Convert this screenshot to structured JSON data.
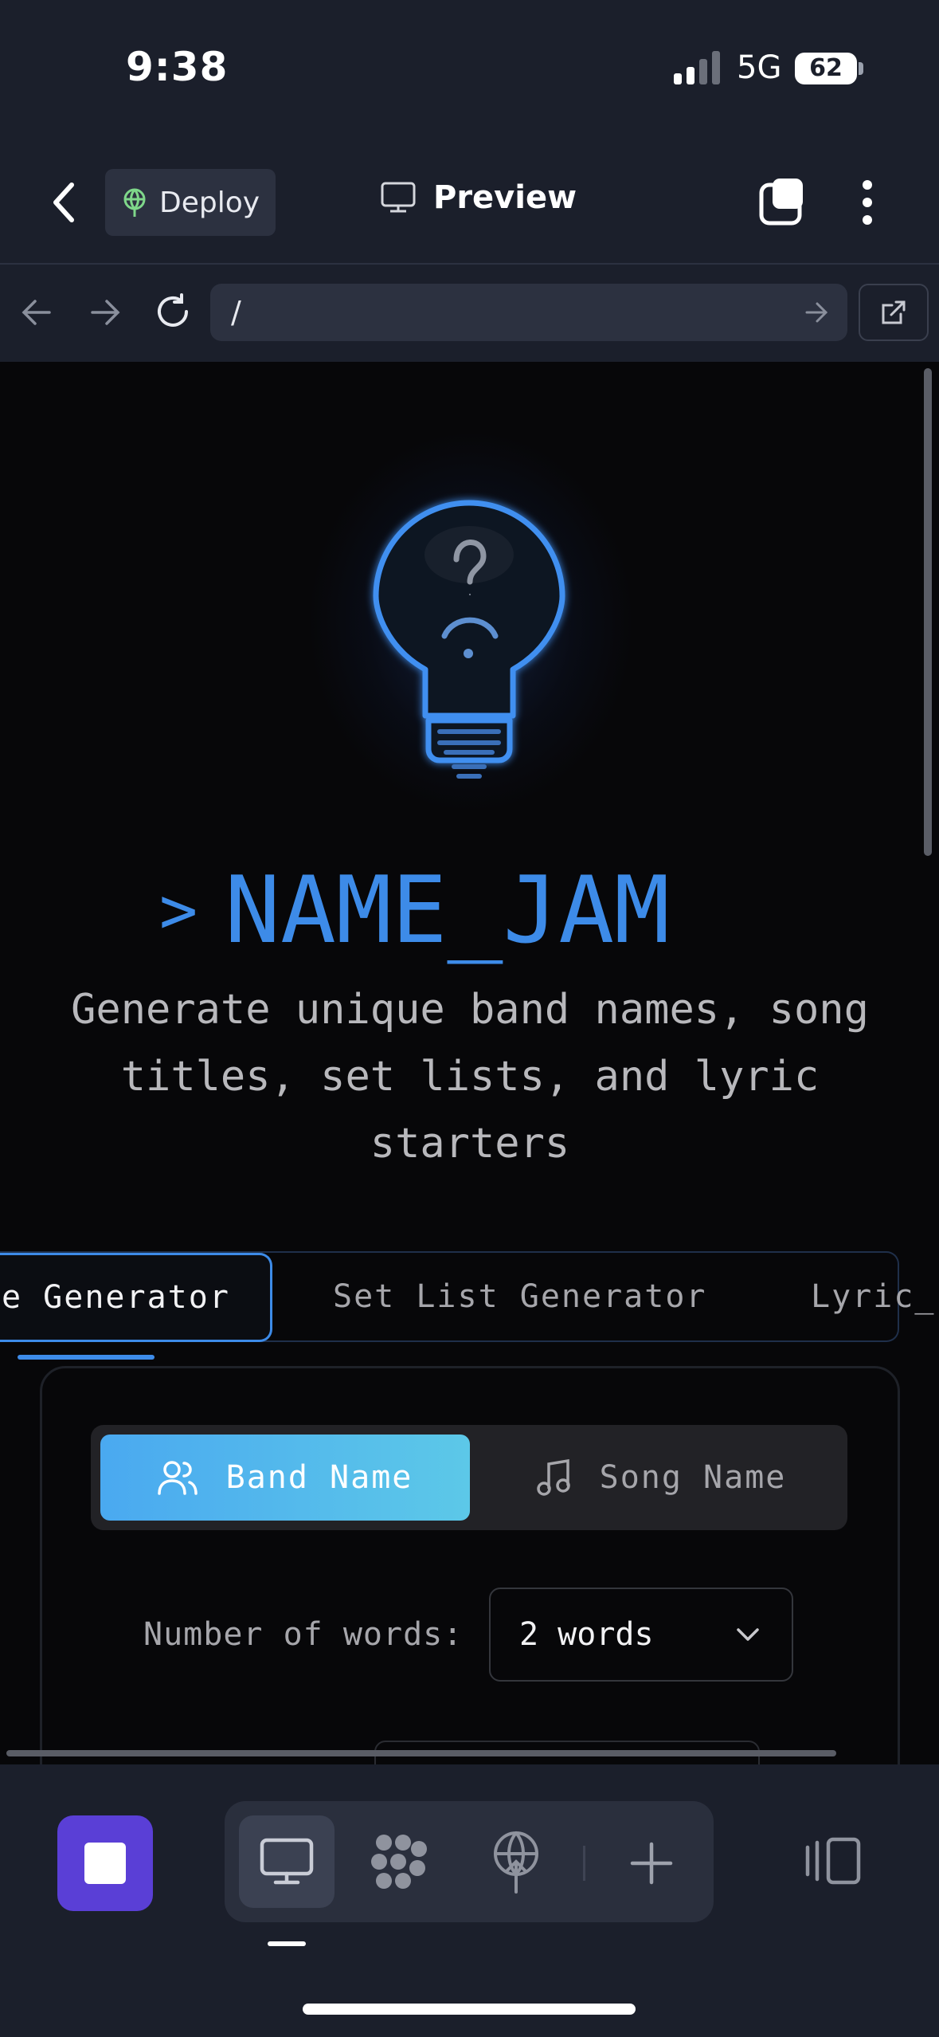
{
  "status_bar": {
    "time": "9:38",
    "network": "5G",
    "battery": "62"
  },
  "toolbar": {
    "deploy_label": "Deploy",
    "preview_label": "Preview"
  },
  "browser": {
    "url": "/"
  },
  "app": {
    "title": "NAME_JAM",
    "prompt_symbol": ">",
    "subtitle": "Generate unique band names, song titles, set lists, and lyric starters",
    "tabs": [
      {
        "label": "e Generator",
        "active": true
      },
      {
        "label": "Set List Generator",
        "active": false
      },
      {
        "label": "Lyric_",
        "active": false
      }
    ],
    "mode_toggle": {
      "band_label": "Band Name",
      "song_label": "Song Name",
      "selected": "Band Name"
    },
    "words": {
      "label": "Number of words:",
      "value": "2 words"
    }
  },
  "colors": {
    "accent": "#3d8be8",
    "toggle_gradient_start": "#4aa9f0",
    "toggle_gradient_end": "#5cc8e8",
    "stop_button": "#5a3fd6",
    "deploy_icon": "#7fd78a"
  },
  "icons": {
    "back": "chevron-left-icon",
    "deploy": "globe-network-icon",
    "preview": "monitor-icon",
    "tabs": "tabs-icon",
    "more": "more-vertical-icon",
    "hero": "lightbulb-icon",
    "band": "users-icon",
    "song": "music-note-icon",
    "dropdown": "chevron-down-icon"
  }
}
